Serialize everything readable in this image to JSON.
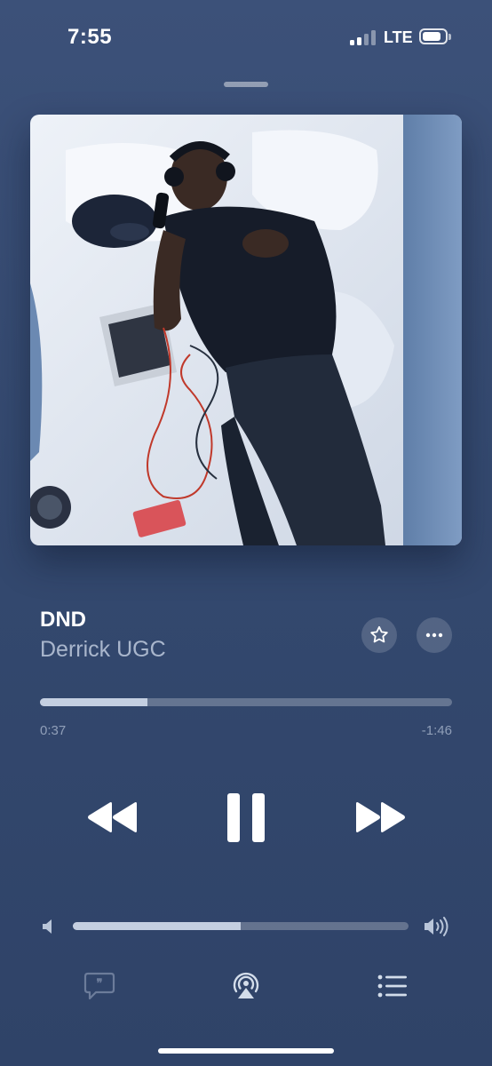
{
  "status_bar": {
    "time": "7:55",
    "network": "LTE",
    "signal_bars": 4,
    "signal_bars_active": 2,
    "battery_level": 0.7
  },
  "track": {
    "title": "DND",
    "artist": "Derrick UGC"
  },
  "playback": {
    "elapsed": "0:37",
    "remaining": "-1:46",
    "progress": 0.26,
    "state": "playing"
  },
  "volume": {
    "level": 0.5
  },
  "icons": {
    "favorite": "star-icon",
    "more": "ellipsis-icon",
    "rewind": "rewind-icon",
    "pause": "pause-icon",
    "fast_forward": "fast-forward-icon",
    "volume_low": "speaker-low-icon",
    "volume_high": "speaker-high-icon",
    "lyrics": "lyrics-quote-icon",
    "airplay": "airplay-icon",
    "queue": "queue-list-icon"
  },
  "colors": {
    "background": "#34496f",
    "accent": "#ffffff",
    "secondary_text": "#b7c3d6"
  }
}
